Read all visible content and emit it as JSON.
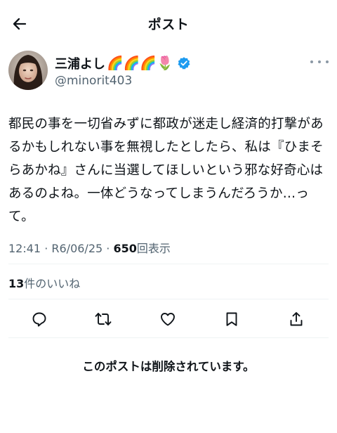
{
  "header": {
    "back_icon": "arrow-left-icon",
    "title": "ポスト"
  },
  "author": {
    "display_name": "三浦よし",
    "name_emoji": "🌈🌈🌈🌷",
    "verified_icon": "verified-badge-icon",
    "verified_color": "#1d9bf0",
    "handle": "@minorit403",
    "more_icon": "more-horizontal-icon"
  },
  "tweet": {
    "text": "都民の事を一切省みずに都政が迷走し経済的打撃があるかもしれない事を無視したとしたら、私は『ひまそらあかね』さんに当選してほしいという邪な好奇心はあるのよね。一体どうなってしまうんだろうか…って。"
  },
  "meta": {
    "time": "12:41",
    "sep1": " · ",
    "date": "R6/06/25",
    "sep2": " · ",
    "views_count": "650",
    "views_label": "回表示"
  },
  "engagement": {
    "likes_count": "13",
    "likes_label": "件のいいね"
  },
  "actions": [
    {
      "icon": "reply-icon"
    },
    {
      "icon": "repost-icon"
    },
    {
      "icon": "like-icon"
    },
    {
      "icon": "bookmark-icon"
    },
    {
      "icon": "share-icon"
    }
  ],
  "deleted_notice": "このポストは削除されています。",
  "colors": {
    "text": "#0f1419",
    "secondary": "#536471",
    "divider": "#eff3f4",
    "accent": "#1d9bf0"
  }
}
